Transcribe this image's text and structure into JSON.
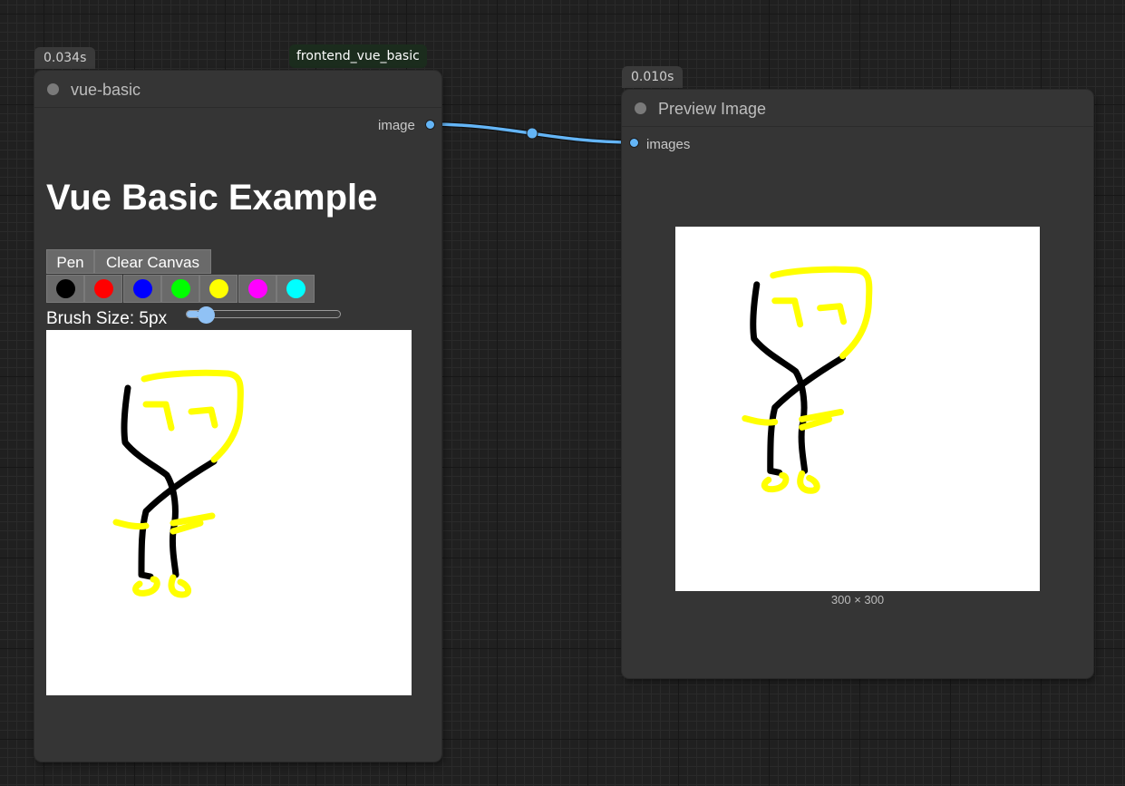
{
  "link": {
    "color": "#64b5f6"
  },
  "group": {
    "label": "frontend_vue_basic"
  },
  "vue_node": {
    "timing": "0.034s",
    "title": "vue-basic",
    "output_slot": "image",
    "heading": "Vue Basic Example",
    "tools": {
      "pen_label": "Pen",
      "clear_label": "Clear Canvas"
    },
    "swatches": [
      {
        "name": "black",
        "color": "#000000"
      },
      {
        "name": "red",
        "color": "#ff0000"
      },
      {
        "name": "blue",
        "color": "#0000ff"
      },
      {
        "name": "green",
        "color": "#00ff00"
      },
      {
        "name": "yellow",
        "color": "#ffff00"
      },
      {
        "name": "magenta",
        "color": "#ff00ff"
      },
      {
        "name": "cyan",
        "color": "#00ffff"
      }
    ],
    "brush": {
      "label": "Brush Size: 5px",
      "value_fraction": 0.08
    }
  },
  "preview_node": {
    "timing": "0.010s",
    "title": "Preview Image",
    "input_slot": "images",
    "image_dims": "300 × 300"
  }
}
